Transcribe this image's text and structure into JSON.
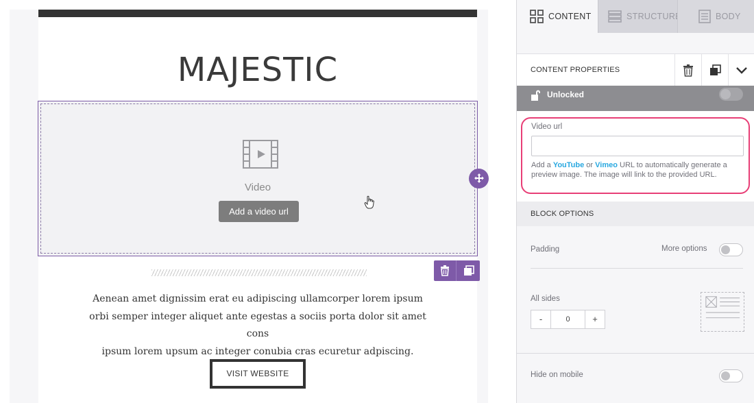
{
  "email": {
    "brand": "MAJESTIC",
    "video_label": "Video",
    "add_video_button": "Add a video url",
    "body_lines": [
      "Aenean amet dignissim erat eu adipiscing ullamcorper lorem ipsum",
      "orbi semper integer aliquet ante egestas a sociis porta dolor sit amet cons",
      "ipsum lorem upsum ac integer conubia cras ecuretur adpiscing."
    ],
    "visit_button": "VISIT WEBSITE"
  },
  "tabs": [
    {
      "label": "CONTENT",
      "icon": "grid-icon",
      "active": true
    },
    {
      "label": "STRUCTURE",
      "icon": "rows-icon",
      "active": false
    },
    {
      "label": "BODY",
      "icon": "document-icon",
      "active": false
    }
  ],
  "properties": {
    "title": "CONTENT PROPERTIES",
    "lock_label": "Unlocked",
    "video_url": {
      "label": "Video url",
      "value": "",
      "help_prefix": "Add a ",
      "help_link1": "YouTube",
      "help_mid": " or ",
      "help_link2": "Vimeo",
      "help_suffix": " URL to automatically generate a preview image. The image will link to the provided URL."
    }
  },
  "block_options": {
    "title": "BLOCK OPTIONS",
    "padding_label": "Padding",
    "more_options_label": "More options",
    "all_sides_label": "All sides",
    "minus_label": "-",
    "padding_value": "0",
    "plus_label": "+",
    "hide_mobile_label": "Hide on mobile"
  },
  "colors": {
    "accent": "#7e5aa8",
    "highlight": "#e83e76",
    "link": "#29a8e0"
  }
}
